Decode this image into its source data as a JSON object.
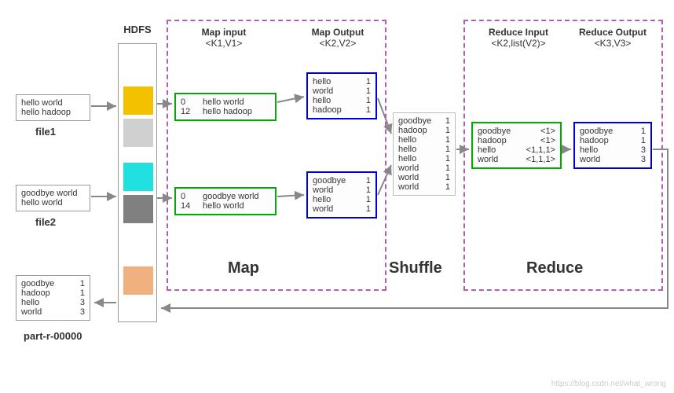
{
  "hdfs": {
    "title": "HDFS"
  },
  "file1": {
    "label": "file1",
    "line1": "hello world",
    "line2": "hello hadoop"
  },
  "file2": {
    "label": "file2",
    "line1": "goodbye world",
    "line2": "hello world"
  },
  "output_file": {
    "label": "part-r-00000",
    "r0k": "goodbye",
    "r0v": "1",
    "r1k": "hadoop",
    "r1v": "1",
    "r2k": "hello",
    "r2v": "3",
    "r3k": "world",
    "r3v": "3"
  },
  "map": {
    "input_title": "Map input",
    "input_sub": "<K1,V1>",
    "output_title": "Map Output",
    "output_sub": "<K2,V2>",
    "stage": "Map",
    "in1": {
      "r0k": "0",
      "r0v": "hello world",
      "r1k": "12",
      "r1v": "hello hadoop"
    },
    "in2": {
      "r0k": "0",
      "r0v": "goodbye world",
      "r1k": "14",
      "r1v": "hello world"
    },
    "out1": {
      "r0k": "hello",
      "r0v": "1",
      "r1k": "world",
      "r1v": "1",
      "r2k": "hello",
      "r2v": "1",
      "r3k": "hadoop",
      "r3v": "1"
    },
    "out2": {
      "r0k": "goodbye",
      "r0v": "1",
      "r1k": "world",
      "r1v": "1",
      "r2k": "hello",
      "r2v": "1",
      "r3k": "world",
      "r3v": "1"
    }
  },
  "shuffle": {
    "stage": "Shuffle",
    "r0k": "goodbye",
    "r0v": "1",
    "r1k": "hadoop",
    "r1v": "1",
    "r2k": "hello",
    "r2v": "1",
    "r3k": "hello",
    "r3v": "1",
    "r4k": "hello",
    "r4v": "1",
    "r5k": "world",
    "r5v": "1",
    "r6k": "world",
    "r6v": "1",
    "r7k": "world",
    "r7v": "1"
  },
  "reduce": {
    "input_title": "Reduce Input",
    "input_sub": "<K2,list(V2)>",
    "output_title": "Reduce Output",
    "output_sub": "<K3,V3>",
    "stage": "Reduce",
    "in": {
      "r0k": "goodbye",
      "r0v": "<1>",
      "r1k": "hadoop",
      "r1v": "<1>",
      "r2k": "hello",
      "r2v": "<1,1,1>",
      "r3k": "world",
      "r3v": "<1,1,1>"
    },
    "out": {
      "r0k": "goodbye",
      "r0v": "1",
      "r1k": "hadoop",
      "r1v": "1",
      "r2k": "hello",
      "r2v": "3",
      "r3k": "world",
      "r3v": "3"
    }
  },
  "watermark": "https://blog.csdn.net/what_wrong",
  "colors": {
    "block1": "#f2c200",
    "block2": "#d0d0d0",
    "block3": "#20e0e0",
    "block4": "#808080",
    "block5": "#f0b080"
  }
}
